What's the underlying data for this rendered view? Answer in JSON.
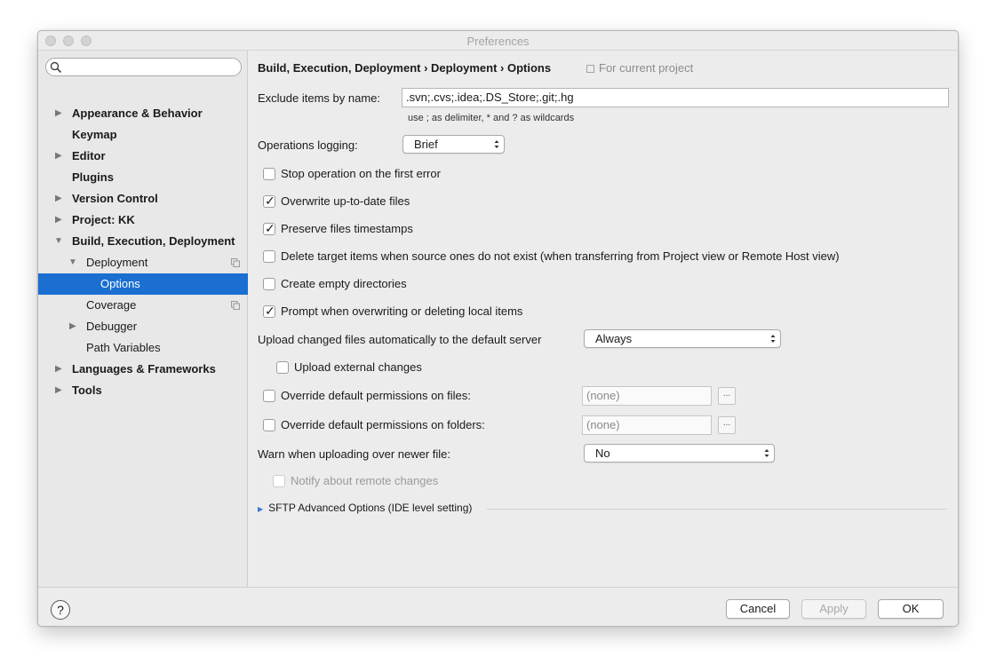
{
  "window": {
    "title": "Preferences"
  },
  "sidebar": {
    "search": {
      "placeholder": "",
      "value": ""
    },
    "items": [
      {
        "label": "Appearance & Behavior"
      },
      {
        "label": "Keymap"
      },
      {
        "label": "Editor"
      },
      {
        "label": "Plugins"
      },
      {
        "label": "Version Control"
      },
      {
        "label": "Project: KK"
      },
      {
        "label": "Build, Execution, Deployment"
      },
      {
        "label": "Deployment"
      },
      {
        "label": "Options"
      },
      {
        "label": "Coverage"
      },
      {
        "label": "Debugger"
      },
      {
        "label": "Path Variables"
      },
      {
        "label": "Languages & Frameworks"
      },
      {
        "label": "Tools"
      }
    ],
    "selected": "Options"
  },
  "main": {
    "breadcrumb": "Build, Execution, Deployment › Deployment › Options",
    "scope_label": "For current project",
    "exclude": {
      "label": "Exclude items by name:",
      "value": ".svn;.cvs;.idea;.DS_Store;.git;.hg",
      "hint": "use ; as delimiter, * and ? as wildcards"
    },
    "operations_logging": {
      "label": "Operations logging:",
      "value": "Brief"
    },
    "checkboxes": [
      {
        "label": "Stop operation on the first error",
        "checked": false
      },
      {
        "label": "Overwrite up-to-date files",
        "checked": true
      },
      {
        "label": "Preserve files timestamps",
        "checked": true
      },
      {
        "label": "Delete target items when source ones do not exist (when transferring from Project view or Remote Host view)",
        "checked": false
      },
      {
        "label": "Create empty directories",
        "checked": false
      },
      {
        "label": "Prompt when overwriting or deleting local items",
        "checked": true
      }
    ],
    "upload_changed": {
      "label": "Upload changed files automatically to the default server",
      "value": "Always"
    },
    "upload_external": {
      "label": "Upload external changes",
      "checked": false
    },
    "override_files": {
      "label": "Override default permissions on files:",
      "checked": false,
      "value": "(none)",
      "button": "..."
    },
    "override_folders": {
      "label": "Override default permissions on folders:",
      "checked": false,
      "value": "(none)",
      "button": "..."
    },
    "warn_newer": {
      "label": "Warn when uploading over newer file:",
      "value": "No"
    },
    "notify_remote": {
      "label": "Notify about remote changes",
      "checked": false,
      "enabled": false
    },
    "sftp_section": {
      "label": "SFTP Advanced Options (IDE level setting)"
    }
  },
  "footer": {
    "help": "?",
    "cancel": "Cancel",
    "apply": "Apply",
    "ok": "OK"
  }
}
